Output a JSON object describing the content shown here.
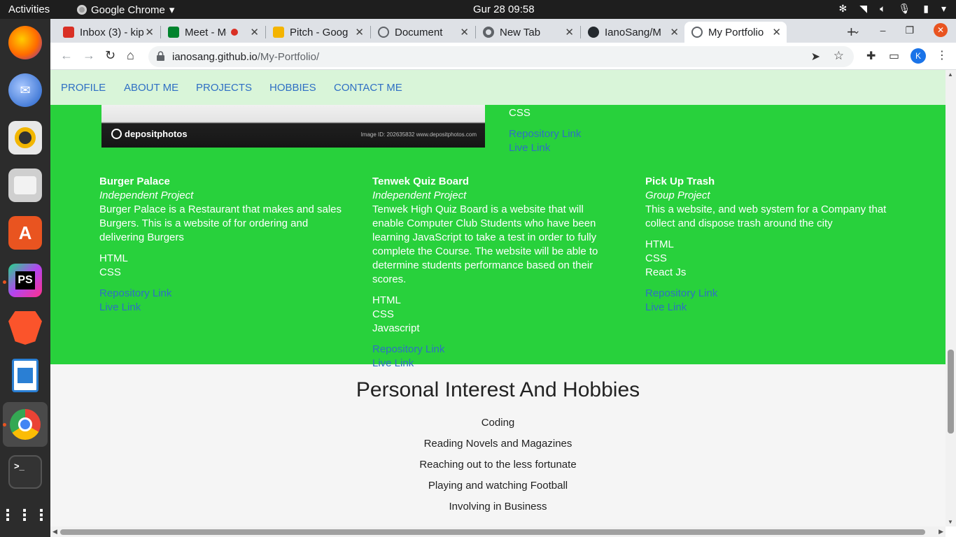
{
  "system": {
    "activities": "Activities",
    "app_name": "Google Chrome",
    "clock": "Gur 28  09:58"
  },
  "tabs": [
    {
      "title": "Inbox (3) - kip",
      "icon": "gmail-icon",
      "color": "#d93025"
    },
    {
      "title": "Meet - Mo",
      "icon": "meet-icon",
      "color": "#00832d"
    },
    {
      "title": "Pitch - Google",
      "icon": "slides-icon",
      "color": "#f4b400"
    },
    {
      "title": "Document",
      "icon": "globe-icon",
      "color": "#5f6368"
    },
    {
      "title": "New Tab",
      "icon": "chrome-icon",
      "color": "#5f6368"
    },
    {
      "title": "IanoSang/M",
      "icon": "github-icon",
      "color": "#24292e"
    },
    {
      "title": "My Portfolio",
      "icon": "globe-icon",
      "color": "#5f6368"
    }
  ],
  "address_bar": {
    "domain": "ianosang.github.io",
    "path": "/My-Portfolio/",
    "profile_initial": "K"
  },
  "nav": [
    "PROFILE",
    "ABOUT ME",
    "PROJECTS",
    "HOBBIES",
    "CONTACT ME"
  ],
  "image_watermark": {
    "brand": "depositphotos",
    "meta": "Image ID: 202635832    www.depositphotos.com"
  },
  "top_project_tail": {
    "tech": "CSS",
    "repo": "Repository Link",
    "live": "Live Link"
  },
  "projects": [
    {
      "name": "Burger Palace",
      "kind": "Independent Project",
      "desc": "Burger Palace is a Restaurant that makes and sales Burgers. This is a website of for ordering and delivering Burgers",
      "tech": [
        "HTML",
        "CSS"
      ],
      "repo": "Repository Link",
      "live": "Live Link"
    },
    {
      "name": "Tenwek Quiz Board",
      "kind": "Independent Project",
      "desc": "Tenwek High Quiz Board is a website that will enable Computer Club Students who have been learning JavaScript to take a test in order to fully complete the Course. The website will be able to determine students performance based on their scores.",
      "tech": [
        "HTML",
        "CSS",
        "Javascript"
      ],
      "repo": "Repository Link",
      "live": "Live Link"
    },
    {
      "name": "Pick Up Trash",
      "kind": "Group Project",
      "desc": "This a website, and web system for a Company that collect and dispose trash around the city",
      "tech": [
        "HTML",
        "CSS",
        "React Js"
      ],
      "repo": "Repository Link",
      "live": "Live Link"
    }
  ],
  "hobbies": {
    "title": "Personal Interest And Hobbies",
    "items": [
      "Coding",
      "Reading Novels and Magazines",
      "Reaching out to the less fortunate",
      "Playing and watching Football",
      "Involving in Business"
    ]
  }
}
